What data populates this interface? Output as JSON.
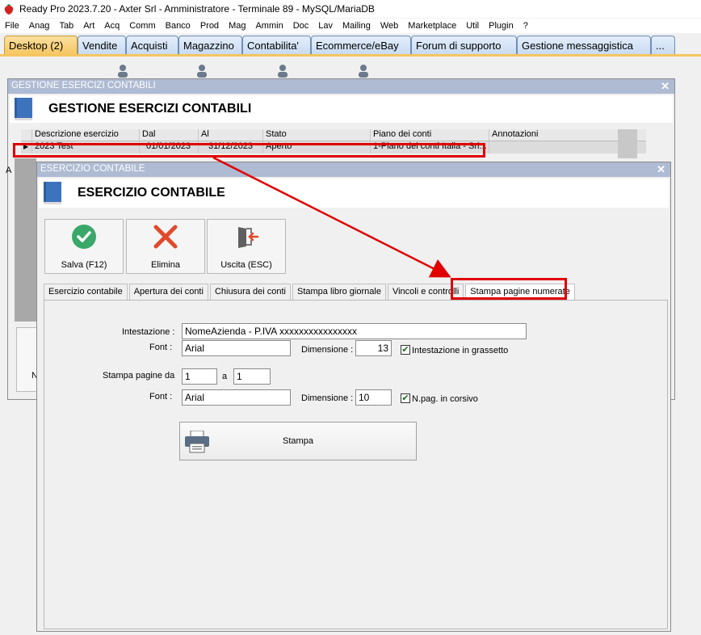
{
  "app": {
    "title": "Ready Pro 2023.7.20 - Axter Srl - Amministratore - Terminale 89 - MySQL/MariaDB"
  },
  "menu": [
    "File",
    "Anag",
    "Tab",
    "Art",
    "Acq",
    "Comm",
    "Banco",
    "Prod",
    "Mag",
    "Ammin",
    "Doc",
    "Lav",
    "Mailing",
    "Web",
    "Marketplace",
    "Util",
    "Plugin",
    "?"
  ],
  "tabs": [
    "Desktop (2)",
    "Vendite",
    "Acquisti",
    "Magazzino",
    "Contabilita'",
    "Ecommerce/eBay",
    "Forum di supporto",
    "Gestione messaggistica",
    "..."
  ],
  "outer_window": {
    "title": "GESTIONE ESERCIZI CONTABILI",
    "heading": "GESTIONE ESERCIZI CONTABILI",
    "columns": [
      "Descrizione esercizio",
      "Dal",
      "Al",
      "Stato",
      "Piano dei conti",
      "Annotazioni"
    ],
    "row": {
      "marker": "▶",
      "descrizione": "2023 Test",
      "dal": "01/01/2023",
      "al": "31/12/2023",
      "stato": "Aperto",
      "piano": "1-Piano dei conti Italia - Srl...",
      "annotazioni": ""
    },
    "side_letters": [
      "A",
      "N"
    ]
  },
  "inner_window": {
    "title": "ESERCIZIO CONTABILE",
    "heading": "ESERCIZIO CONTABILE",
    "buttons": {
      "save": "Salva (F12)",
      "delete": "Elimina",
      "exit": "Uscita (ESC)"
    },
    "subtabs": [
      "Esercizio contabile",
      "Apertura dei conti",
      "Chiusura dei conti",
      "Stampa libro giornale",
      "Vincoli e controlli",
      "Stampa pagine numerate"
    ],
    "active_subtab": 5,
    "form": {
      "intestazione_label": "Intestazione :",
      "intestazione_value": "NomeAzienda - P.IVA xxxxxxxxxxxxxxxx",
      "font1_label": "Font :",
      "font1_value": "Arial",
      "dim1_label": "Dimensione :",
      "dim1_value": "13",
      "bold_label": "Intestazione in grassetto",
      "bold_checked": true,
      "pages_label": "Stampa pagine da",
      "page_from": "1",
      "a_label": "a",
      "page_to": "1",
      "font2_label": "Font :",
      "font2_value": "Arial",
      "dim2_label": "Dimensione :",
      "dim2_value": "10",
      "italic_label": "N.pag. in corsivo",
      "italic_checked": true,
      "print_label": "Stampa"
    }
  },
  "colors": {
    "accent_red": "#e00000",
    "titlebar_blue": "#aebbd3",
    "active_tab": "#f5c560"
  }
}
